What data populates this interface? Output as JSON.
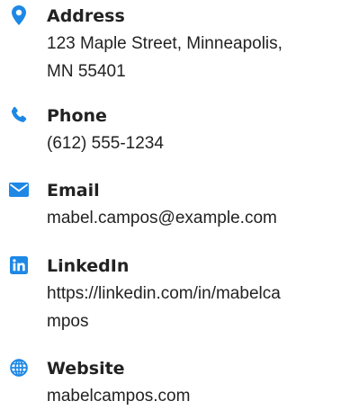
{
  "colors": {
    "icon": "#1e88e5",
    "text": "#222222"
  },
  "items": [
    {
      "icon": "location-pin-icon",
      "label": "Address",
      "value_lines": [
        "123 Maple Street, Minneapolis,",
        "MN 55401"
      ]
    },
    {
      "icon": "phone-icon",
      "label": "Phone",
      "value_lines": [
        "(612) 555-1234"
      ]
    },
    {
      "icon": "envelope-icon",
      "label": "Email",
      "value_lines": [
        "mabel.campos@example.com"
      ]
    },
    {
      "icon": "linkedin-icon",
      "label": "LinkedIn",
      "value_lines": [
        "https://linkedin.com/in/mabelca",
        "mpos"
      ]
    },
    {
      "icon": "globe-icon",
      "label": "Website",
      "value_lines": [
        "mabelcampos.com"
      ]
    }
  ]
}
